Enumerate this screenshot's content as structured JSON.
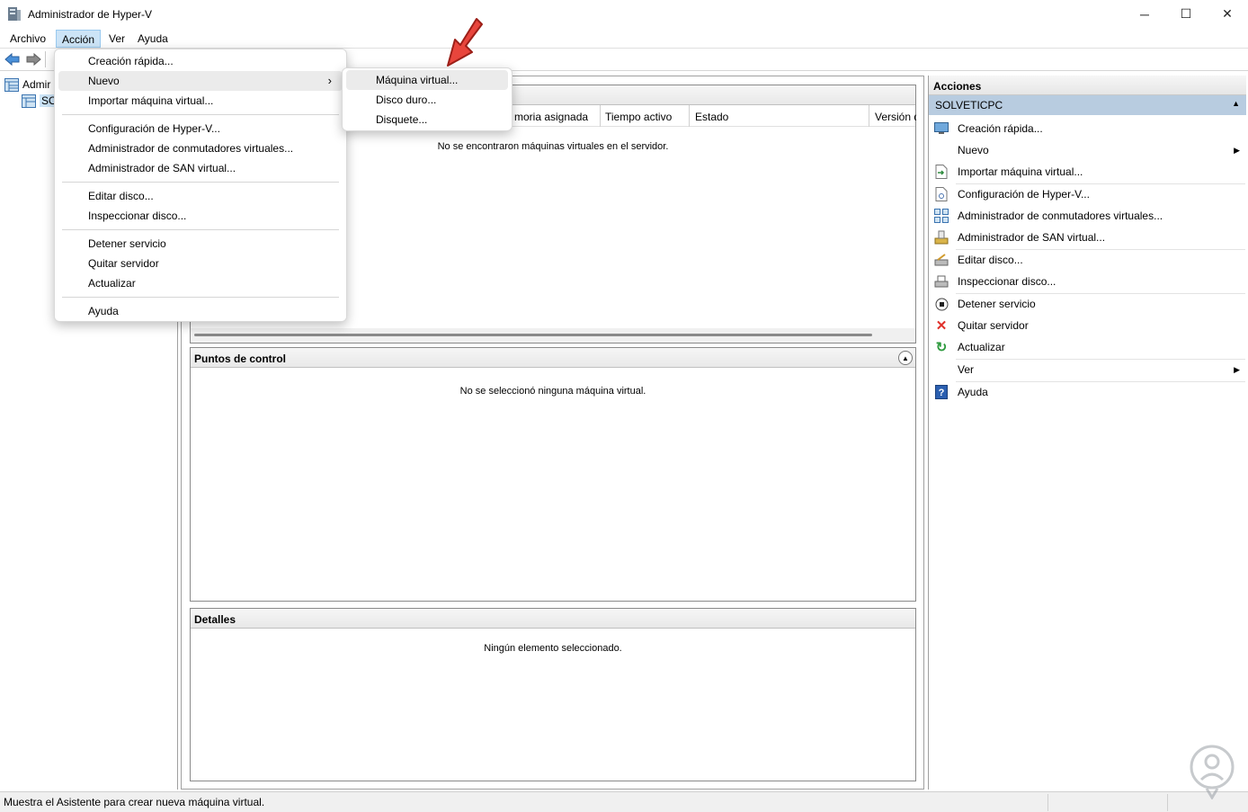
{
  "window": {
    "title": "Administrador de Hyper-V",
    "minimize": "─",
    "maximize": "☐",
    "close": "✕"
  },
  "menubar": [
    "Archivo",
    "Acción",
    "Ver",
    "Ayuda"
  ],
  "tree": {
    "root": "Admir",
    "server": "SO"
  },
  "accion_menu": {
    "items": [
      "Creación rápida...",
      "Nuevo",
      "Importar máquina virtual...",
      "Configuración de Hyper-V...",
      "Administrador de conmutadores virtuales...",
      "Administrador de SAN virtual...",
      "Editar disco...",
      "Inspeccionar disco...",
      "Detener servicio",
      "Quitar servidor",
      "Actualizar",
      "Ayuda"
    ],
    "submenu_arrow": "›"
  },
  "nuevo_submenu": [
    "Máquina virtual...",
    "Disco duro...",
    "Disquete..."
  ],
  "vm_panel": {
    "columns": [
      "moria asignada",
      "Tiempo activo",
      "Estado",
      "Versión d"
    ],
    "empty": "No se encontraron máquinas virtuales en el servidor."
  },
  "checkpoints": {
    "title": "Puntos de control",
    "empty": "No se seleccionó ninguna máquina virtual."
  },
  "details": {
    "title": "Detalles",
    "empty": "Ningún elemento seleccionado."
  },
  "actions": {
    "title": "Acciones",
    "server": "SOLVETICPC",
    "items": [
      "Creación rápida...",
      "Nuevo",
      "Importar máquina virtual...",
      "Configuración de Hyper-V...",
      "Administrador de conmutadores virtuales...",
      "Administrador de SAN virtual...",
      "Editar disco...",
      "Inspeccionar disco...",
      "Detener servicio",
      "Quitar servidor",
      "Actualizar",
      "Ver",
      "Ayuda"
    ]
  },
  "status": "Muestra el Asistente para crear nueva máquina virtual.",
  "colors": {
    "accent_header": "#b8cce0",
    "menu_active": "#cce4f7",
    "arrow_red": "#e8453c"
  }
}
